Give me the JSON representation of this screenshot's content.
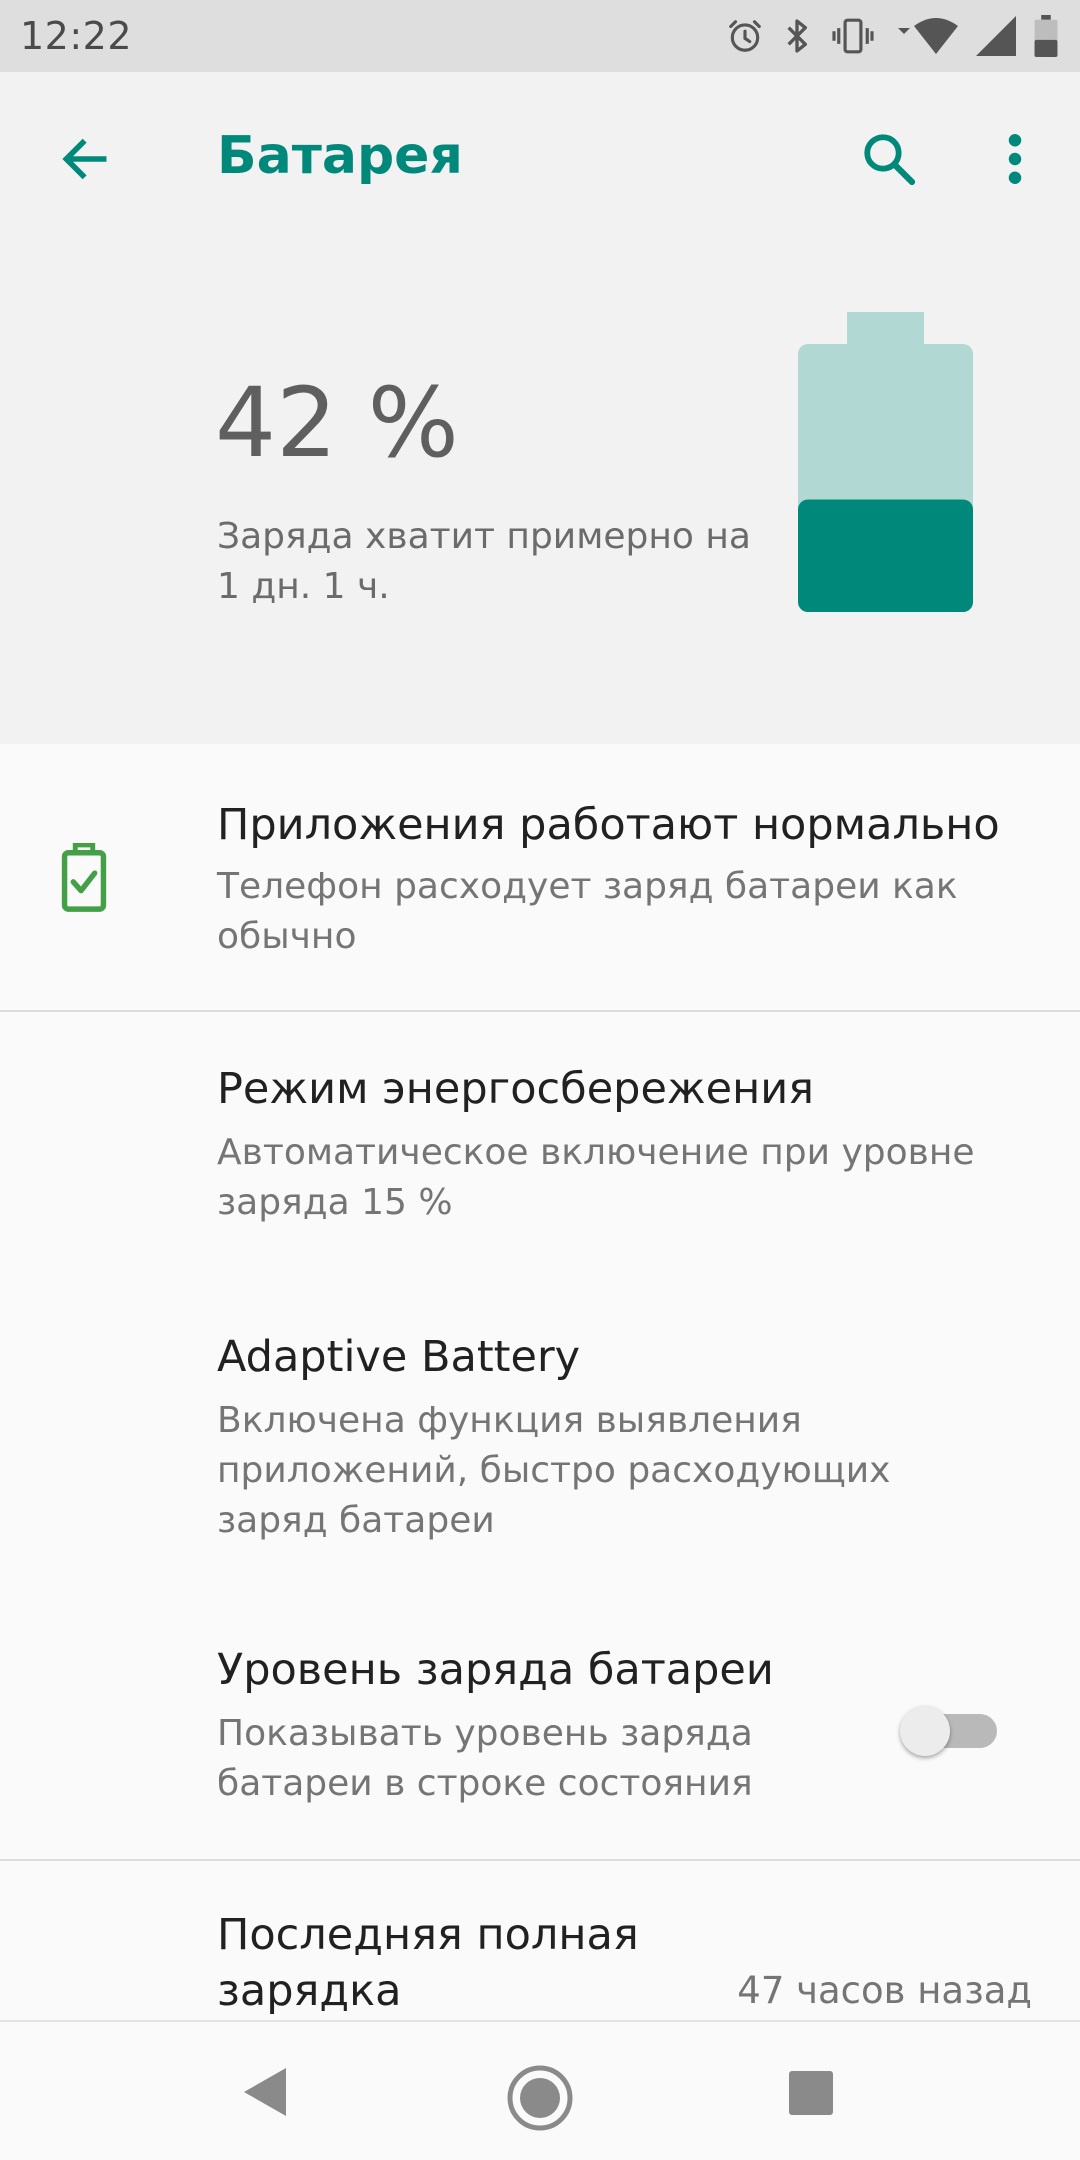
{
  "status_bar": {
    "time": "12:22",
    "icons": [
      "alarm-icon",
      "bluetooth-icon",
      "vibrate-icon",
      "wifi-icon",
      "signal-icon",
      "battery-icon"
    ]
  },
  "app_bar": {
    "title": "Батарея",
    "back_icon": "arrow-left-icon",
    "search_icon": "search-icon",
    "more_icon": "more-vert-icon"
  },
  "battery": {
    "percent_text": "42 %",
    "level_percent": 42,
    "estimate": "Заряда хватит примерно на 1 дн. 1 ч."
  },
  "items": {
    "apps_status": {
      "title": "Приложения работают нормально",
      "subtitle": "Телефон расходует заряд батареи как обычно",
      "icon": "battery-check-icon"
    },
    "saver": {
      "title": "Режим энергосбережения",
      "subtitle": "Автоматическое включение при уровне заряда 15 %"
    },
    "adaptive": {
      "title": "Adaptive Battery",
      "subtitle": "Включена функция выявления приложений, быстро расходующих заряд батареи"
    },
    "percentage": {
      "title": "Уровень заряда батареи",
      "subtitle": "Показывать уровень заряда батареи в строке состояния",
      "toggle_on": false
    },
    "last_charge": {
      "title": "Последняя полная зарядка",
      "value": "47 часов назад"
    }
  },
  "colors": {
    "accent": "#00897b",
    "battery_empty": "#b2d8d3",
    "battery_fill": "#00897b",
    "ok_green": "#43a047"
  },
  "nav_bar": {
    "back_icon": "nav-back-icon",
    "home_icon": "nav-home-icon",
    "recents_icon": "nav-recents-icon"
  }
}
